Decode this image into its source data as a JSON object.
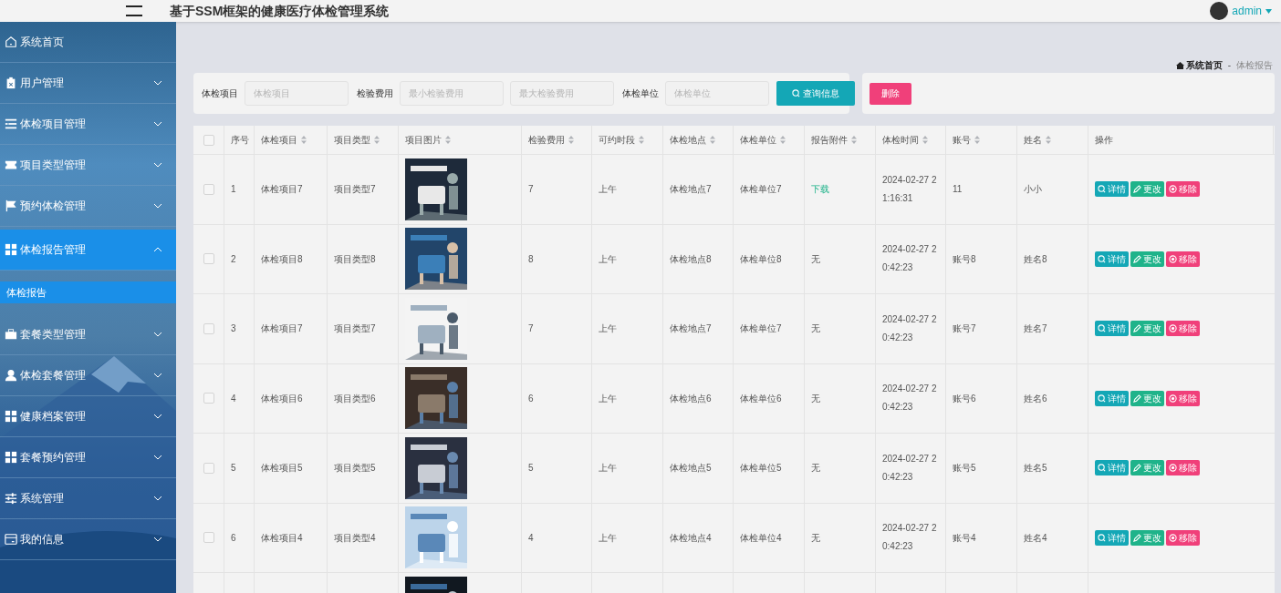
{
  "header": {
    "title": "基于SSM框架的健康医疗体检管理系统",
    "user": "admin"
  },
  "sidebar": {
    "items": [
      {
        "label": "系统首页",
        "selected": false
      },
      {
        "label": "用户管理",
        "expanded": false,
        "selected": false
      },
      {
        "label": "体检项目管理",
        "expanded": false,
        "selected": false
      },
      {
        "label": "项目类型管理",
        "expanded": false,
        "selected": false
      },
      {
        "label": "预约体检管理",
        "expanded": false,
        "selected": false
      },
      {
        "label": "体检报告管理",
        "expanded": true,
        "selected": true,
        "children": [
          {
            "label": "体检报告",
            "selected": true
          }
        ]
      },
      {
        "label": "套餐类型管理",
        "expanded": false,
        "selected": false
      },
      {
        "label": "体检套餐管理",
        "expanded": false,
        "selected": false
      },
      {
        "label": "健康档案管理",
        "expanded": false,
        "selected": false
      },
      {
        "label": "套餐预约管理",
        "expanded": false,
        "selected": false
      },
      {
        "label": "系统管理",
        "expanded": false,
        "selected": false
      },
      {
        "label": "我的信息",
        "expanded": false,
        "selected": false
      }
    ]
  },
  "breadcrumb": {
    "home": "系统首页",
    "separator": "-",
    "current": "体检报告"
  },
  "search": {
    "fields": [
      {
        "label": "体检项目",
        "placeholder": "体检项目"
      },
      {
        "label": "检验费用",
        "placeholder": "最小检验费用"
      },
      {
        "placeholder": "最大检验费用"
      },
      {
        "label": "体检单位",
        "placeholder": "体检单位"
      }
    ],
    "button": "查询信息",
    "delete_button": "删除"
  },
  "table": {
    "all_checked": false,
    "columns": [
      {
        "label": "序号",
        "sortable": false
      },
      {
        "label": "体检项目",
        "sortable": true
      },
      {
        "label": "项目类型",
        "sortable": true
      },
      {
        "label": "项目图片",
        "sortable": true
      },
      {
        "label": "检验费用",
        "sortable": true
      },
      {
        "label": "可约时段",
        "sortable": true
      },
      {
        "label": "体检地点",
        "sortable": true
      },
      {
        "label": "体检单位",
        "sortable": true
      },
      {
        "label": "报告附件",
        "sortable": true
      },
      {
        "label": "体检时间",
        "sortable": true
      },
      {
        "label": "账号",
        "sortable": true
      },
      {
        "label": "姓名",
        "sortable": true
      },
      {
        "label": "操作",
        "sortable": false
      }
    ],
    "rows": [
      {
        "checked": false,
        "no": "1",
        "item": "体检项目7",
        "type": "项目类型7",
        "image": {
          "kind": "picture"
        },
        "fee": "7",
        "slot": "上午",
        "place": "体检地点7",
        "unit": "体检单位7",
        "attachment": {
          "text": "下载",
          "link": true
        },
        "time": "2024-02-27 21:16:31",
        "account": "11",
        "name": "小小",
        "actions": [
          "详情",
          "更改",
          "移除"
        ]
      },
      {
        "checked": false,
        "no": "2",
        "item": "体检项目8",
        "type": "项目类型8",
        "image": {
          "kind": "picture"
        },
        "fee": "8",
        "slot": "上午",
        "place": "体检地点8",
        "unit": "体检单位8",
        "attachment": {
          "text": "无",
          "link": false
        },
        "time": "2024-02-27 20:42:23",
        "account": "账号8",
        "name": "姓名8",
        "actions": [
          "详情",
          "更改",
          "移除"
        ]
      },
      {
        "checked": false,
        "no": "3",
        "item": "体检项目7",
        "type": "项目类型7",
        "image": {
          "kind": "picture"
        },
        "fee": "7",
        "slot": "上午",
        "place": "体检地点7",
        "unit": "体检单位7",
        "attachment": {
          "text": "无",
          "link": false
        },
        "time": "2024-02-27 20:42:23",
        "account": "账号7",
        "name": "姓名7",
        "actions": [
          "详情",
          "更改",
          "移除"
        ]
      },
      {
        "checked": false,
        "no": "4",
        "item": "体检项目6",
        "type": "项目类型6",
        "image": {
          "kind": "picture"
        },
        "fee": "6",
        "slot": "上午",
        "place": "体检地点6",
        "unit": "体检单位6",
        "attachment": {
          "text": "无",
          "link": false
        },
        "time": "2024-02-27 20:42:23",
        "account": "账号6",
        "name": "姓名6",
        "actions": [
          "详情",
          "更改",
          "移除"
        ]
      },
      {
        "checked": false,
        "no": "5",
        "item": "体检项目5",
        "type": "项目类型5",
        "image": {
          "kind": "picture"
        },
        "fee": "5",
        "slot": "上午",
        "place": "体检地点5",
        "unit": "体检单位5",
        "attachment": {
          "text": "无",
          "link": false
        },
        "time": "2024-02-27 20:42:23",
        "account": "账号5",
        "name": "姓名5",
        "actions": [
          "详情",
          "更改",
          "移除"
        ]
      },
      {
        "checked": false,
        "no": "6",
        "item": "体检项目4",
        "type": "项目类型4",
        "image": {
          "kind": "picture"
        },
        "fee": "4",
        "slot": "上午",
        "place": "体检地点4",
        "unit": "体检单位4",
        "attachment": {
          "text": "无",
          "link": false
        },
        "time": "2024-02-27 20:42:23",
        "account": "账号4",
        "name": "姓名4",
        "actions": [
          "详情",
          "更改",
          "移除"
        ]
      },
      {
        "image": {
          "kind": "picture"
        }
      }
    ]
  }
}
